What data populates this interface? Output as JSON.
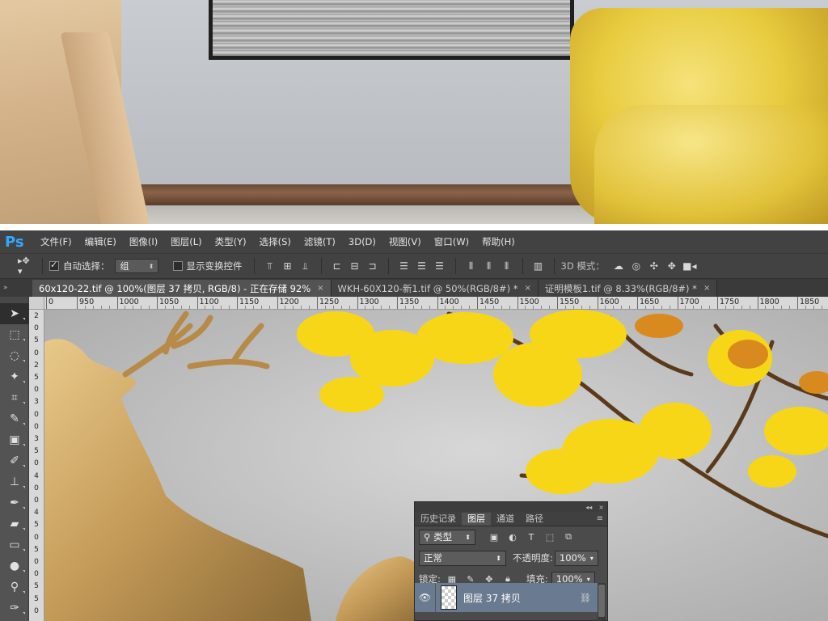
{
  "app": {
    "logo": "Ps",
    "menu": [
      "文件(F)",
      "编辑(E)",
      "图像(I)",
      "图层(L)",
      "类型(Y)",
      "选择(S)",
      "滤镜(T)",
      "3D(D)",
      "视图(V)",
      "窗口(W)",
      "帮助(H)"
    ]
  },
  "options": {
    "auto_select_label": "自动选择：",
    "auto_select_value": "组",
    "transform_label": "显示变换控件",
    "mode_3d_label": "3D 模式："
  },
  "tabs": [
    {
      "label": "60x120-22.tif @ 100%(图层 37 拷贝, RGB/8) - 正在存储 92%",
      "close": "×"
    },
    {
      "label": "WKH-60X120-新1.tif @ 50%(RGB/8#) *",
      "close": "×"
    },
    {
      "label": "证明模板1.tif @ 8.33%(RGB/8#) *",
      "close": "×"
    }
  ],
  "tab_collapse": "»",
  "ruler": {
    "h_labels": [
      "0",
      "950",
      "1000",
      "1050",
      "1100",
      "1150",
      "1200",
      "1250",
      "1300",
      "1350",
      "1400",
      "1450",
      "1500",
      "1550",
      "1600",
      "1650",
      "1700",
      "1750",
      "1800",
      "1850"
    ],
    "v_digits": [
      "2",
      "0",
      "5",
      "0",
      "2",
      "5",
      "0",
      "3",
      "0",
      "0",
      "3",
      "5",
      "0",
      "4",
      "0",
      "0",
      "4",
      "5",
      "0",
      "5",
      "0",
      "0",
      "5",
      "5",
      "0"
    ]
  },
  "layers_panel": {
    "tabs": [
      "历史记录",
      "图层",
      "通道",
      "路径"
    ],
    "active_tab": "图层",
    "filter_label": "类型",
    "blend_mode": "正常",
    "opacity_label": "不透明度:",
    "opacity_value": "100%",
    "lock_label": "锁定:",
    "fill_label": "填充:",
    "fill_value": "100%",
    "layer_name": "图层 37 拷贝",
    "collapse_glyph": "◂◂",
    "close_glyph": "×",
    "menu_glyph": "≡"
  },
  "colors": {
    "ps_blue": "#31a8ff",
    "selected_layer": "#6a7a90",
    "canvas_gray": "#c4c4c4",
    "leaf_yellow": "#f7d618",
    "leaf_orange": "#d98a1e",
    "branch_brown": "#5a3a1a",
    "deer_gold": "#c8a060"
  }
}
